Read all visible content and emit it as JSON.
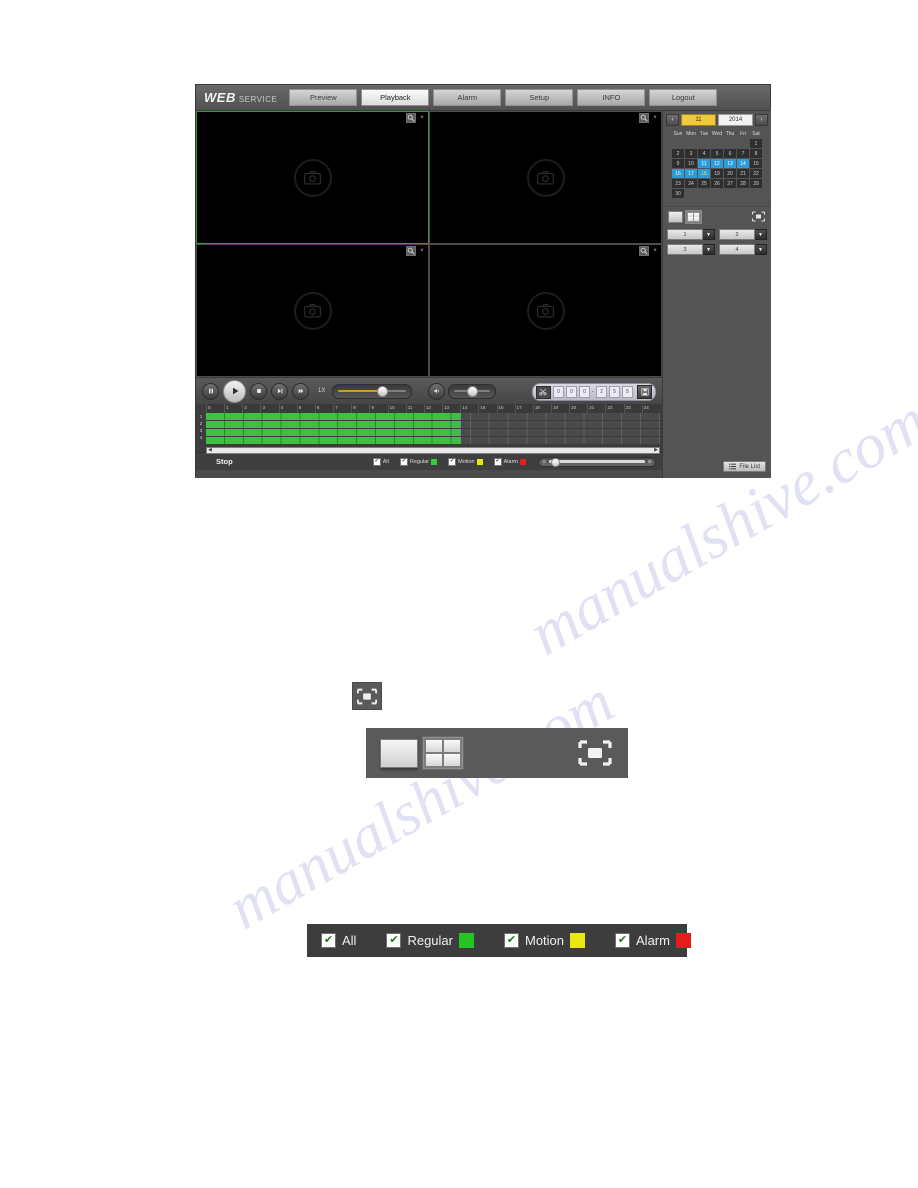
{
  "watermark": {
    "line1": "manualshive.com",
    "line2": "manualshive.com"
  },
  "app": {
    "logo": {
      "web": "WEB",
      "service": "SERVICE"
    },
    "tabs": [
      {
        "label": "Preview",
        "active": false
      },
      {
        "label": "Playback",
        "active": true
      },
      {
        "label": "Alarm",
        "active": false
      },
      {
        "label": "Setup",
        "active": false
      },
      {
        "label": "INFO",
        "active": false
      },
      {
        "label": "Logout",
        "active": false
      }
    ]
  },
  "video": {
    "panes": [
      {
        "selected": true,
        "zoom_icon": "digital-zoom-icon",
        "close_icon": "close-icon",
        "placeholder": "camera-icon"
      },
      {
        "selected": false,
        "zoom_icon": "digital-zoom-icon",
        "close_icon": "close-icon",
        "placeholder": "camera-icon"
      },
      {
        "selected": false,
        "zoom_icon": "digital-zoom-icon",
        "close_icon": "close-icon",
        "placeholder": "camera-icon"
      },
      {
        "selected": false,
        "zoom_icon": "digital-zoom-icon",
        "close_icon": "close-icon",
        "placeholder": "camera-icon"
      }
    ]
  },
  "controls": {
    "pause": "pause-icon",
    "play": "play-icon",
    "stop": "stop-icon",
    "slow": "slow-play-icon",
    "fast": "fast-play-icon",
    "speed_label": "1X",
    "volume_icon": "volume-icon",
    "clip_icon": "clip-scissors-icon",
    "save_icon": "save-icon",
    "time_start": [
      "0",
      "0",
      ":",
      "0",
      "0",
      ":",
      "0",
      "0"
    ],
    "time_end": [
      "2",
      "3",
      ":",
      "5",
      "9",
      ":",
      "5",
      "9"
    ],
    "range_separator": "-"
  },
  "calendar": {
    "prev": "‹",
    "next": "›",
    "month": "11",
    "year": "2014",
    "weekdays": [
      "Sun",
      "Mon",
      "Tue",
      "Wed",
      "Thu",
      "Fri",
      "Sat"
    ],
    "weeks": [
      [
        null,
        null,
        null,
        null,
        null,
        null,
        "1"
      ],
      [
        "2",
        "3",
        "4",
        "5",
        "6",
        "7",
        "8"
      ],
      [
        "9",
        "10",
        "11",
        "12",
        "13",
        "14",
        "15"
      ],
      [
        "16",
        "17",
        "18",
        "19",
        "20",
        "21",
        "22"
      ],
      [
        "23",
        "24",
        "25",
        "26",
        "27",
        "28",
        "29"
      ],
      [
        "30",
        null,
        null,
        null,
        null,
        null,
        null
      ]
    ],
    "has_record": [
      "11",
      "12",
      "13",
      "14",
      "16",
      "17",
      "18"
    ],
    "selected": "18"
  },
  "split": {
    "one_icon": "single-window-icon",
    "four_icon": "four-window-icon",
    "fullscreen_icon": "fullscreen-icon",
    "active": "four"
  },
  "channels": [
    {
      "value": "1",
      "arrow": "▼"
    },
    {
      "value": "2",
      "arrow": "▼"
    },
    {
      "value": "3",
      "arrow": "▼"
    },
    {
      "value": "4",
      "arrow": "▼"
    }
  ],
  "file_list": {
    "label": "File List",
    "icon": "list-icon"
  },
  "timeline": {
    "hours": [
      "0",
      "1",
      "2",
      "3",
      "4",
      "5",
      "6",
      "7",
      "8",
      "9",
      "10",
      "11",
      "12",
      "13",
      "14",
      "15",
      "16",
      "17",
      "18",
      "19",
      "20",
      "21",
      "22",
      "23",
      "24"
    ],
    "channel_labels": [
      "1",
      "2",
      "3",
      "4"
    ],
    "record_color": "#3fc13f",
    "record_end_hour": 13.5,
    "scroll_left": "◀",
    "scroll_right": "▶"
  },
  "status": {
    "text": "Stop",
    "legend": [
      {
        "label": "All",
        "checked": true,
        "color": null
      },
      {
        "label": "Regular",
        "checked": true,
        "color": "#2fd02f"
      },
      {
        "label": "Motion",
        "checked": true,
        "color": "#e8e80f"
      },
      {
        "label": "Alarm",
        "checked": true,
        "color": "#e81f1f"
      }
    ],
    "check_glyph": "✔",
    "zoom_out_icon": "zoom-out-icon",
    "zoom_in_icon": "zoom-in-icon"
  },
  "figures": {
    "fullscreen_callout": {
      "icon": "fullscreen-icon"
    },
    "split_callout": {
      "one_icon": "single-window-icon",
      "four_icon": "four-window-icon",
      "fullscreen_icon": "fullscreen-icon"
    },
    "legend_callout": {
      "items": [
        {
          "label": "All",
          "checked": true,
          "color": null
        },
        {
          "label": "Regular",
          "checked": true,
          "color": "#22c522"
        },
        {
          "label": "Motion",
          "checked": true,
          "color": "#e9e911"
        },
        {
          "label": "Alarm",
          "checked": true,
          "color": "#e61c1c"
        }
      ],
      "check_glyph": "✔"
    }
  }
}
